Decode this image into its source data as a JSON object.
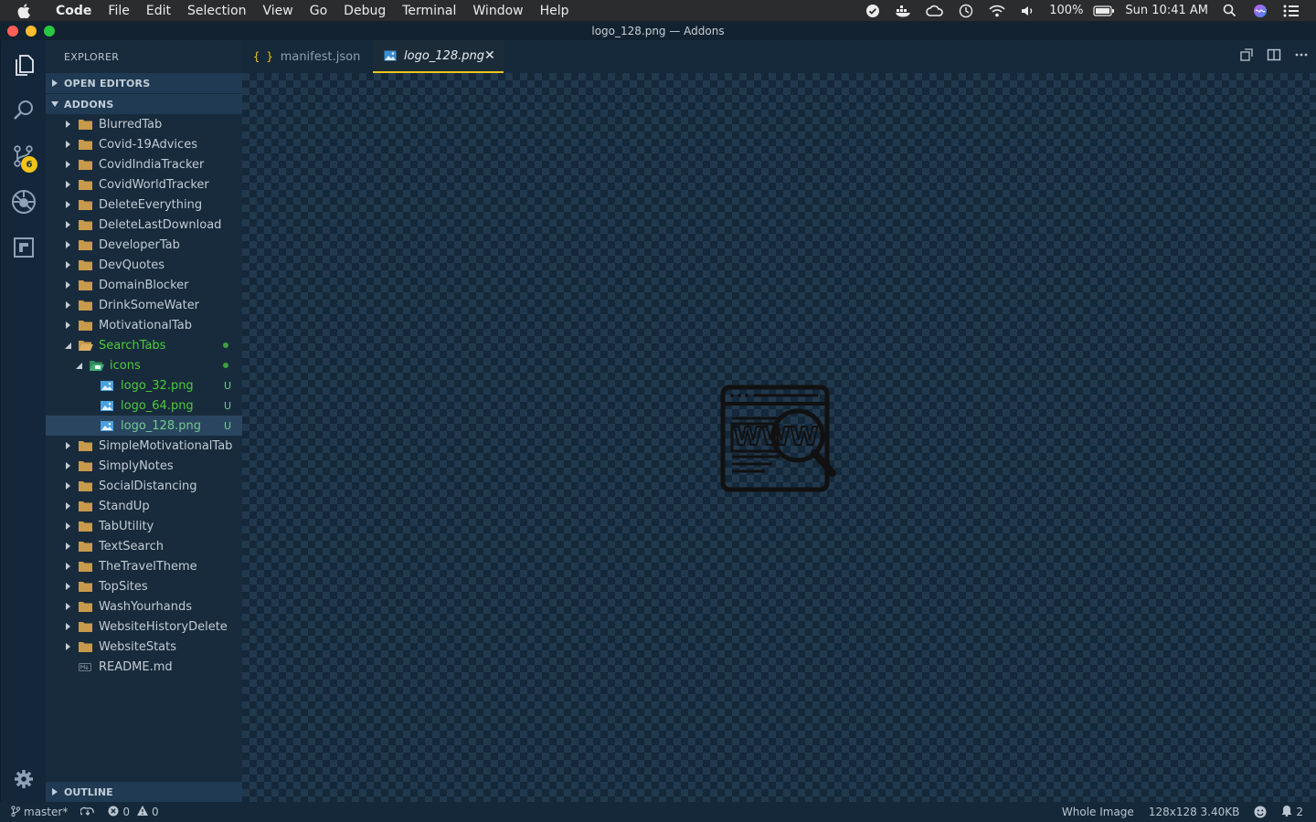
{
  "menubar": {
    "app_name": "Code",
    "items": [
      "File",
      "Edit",
      "Selection",
      "View",
      "Go",
      "Debug",
      "Terminal",
      "Window",
      "Help"
    ],
    "battery": "100%",
    "clock": "Sun 10:41 AM"
  },
  "window": {
    "title": "logo_128.png — Addons"
  },
  "activity": {
    "scm_badge": "6"
  },
  "sidebar": {
    "title": "EXPLORER",
    "open_editors": "OPEN EDITORS",
    "folder": "ADDONS",
    "outline": "OUTLINE",
    "tree": [
      {
        "label": "BlurredTab",
        "kind": "folder",
        "depth": 0
      },
      {
        "label": "Covid-19Advices",
        "kind": "folder",
        "depth": 0
      },
      {
        "label": "CovidIndiaTracker",
        "kind": "folder",
        "depth": 0
      },
      {
        "label": "CovidWorldTracker",
        "kind": "folder",
        "depth": 0
      },
      {
        "label": "DeleteEverything",
        "kind": "folder",
        "depth": 0
      },
      {
        "label": "DeleteLastDownload",
        "kind": "folder",
        "depth": 0
      },
      {
        "label": "DeveloperTab",
        "kind": "folder",
        "depth": 0
      },
      {
        "label": "DevQuotes",
        "kind": "folder",
        "depth": 0
      },
      {
        "label": "DomainBlocker",
        "kind": "folder",
        "depth": 0
      },
      {
        "label": "DrinkSomeWater",
        "kind": "folder",
        "depth": 0
      },
      {
        "label": "MotivationalTab",
        "kind": "folder",
        "depth": 0
      },
      {
        "label": "SearchTabs",
        "kind": "folder-open",
        "depth": 0,
        "dot": true
      },
      {
        "label": "icons",
        "kind": "folder-open-images",
        "depth": 1,
        "dot": true
      },
      {
        "label": "logo_32.png",
        "kind": "image",
        "depth": 2,
        "decor": "U"
      },
      {
        "label": "logo_64.png",
        "kind": "image",
        "depth": 2,
        "decor": "U"
      },
      {
        "label": "logo_128.png",
        "kind": "image",
        "depth": 2,
        "decor": "U",
        "selected": true
      },
      {
        "label": "SimpleMotivationalTab",
        "kind": "folder",
        "depth": 0
      },
      {
        "label": "SimplyNotes",
        "kind": "folder",
        "depth": 0
      },
      {
        "label": "SocialDistancing",
        "kind": "folder",
        "depth": 0
      },
      {
        "label": "StandUp",
        "kind": "folder",
        "depth": 0
      },
      {
        "label": "TabUtility",
        "kind": "folder",
        "depth": 0
      },
      {
        "label": "TextSearch",
        "kind": "folder",
        "depth": 0
      },
      {
        "label": "TheTravelTheme",
        "kind": "folder",
        "depth": 0
      },
      {
        "label": "TopSites",
        "kind": "folder",
        "depth": 0
      },
      {
        "label": "WashYourhands",
        "kind": "folder",
        "depth": 0
      },
      {
        "label": "WebsiteHistoryDelete",
        "kind": "folder",
        "depth": 0
      },
      {
        "label": "WebsiteStats",
        "kind": "folder",
        "depth": 0
      },
      {
        "label": "README.md",
        "kind": "markdown",
        "depth": 0
      }
    ]
  },
  "tabs": [
    {
      "label": "manifest.json",
      "icon": "json-icon",
      "active": false
    },
    {
      "label": "logo_128.png",
      "icon": "image-icon",
      "active": true
    }
  ],
  "image_preview": {
    "logo_text": "WWW"
  },
  "statusbar": {
    "branch": "master*",
    "errors": "0",
    "warnings": "0",
    "zoom": "Whole Image",
    "image_info": "128x128 3.40KB",
    "notifications": "2"
  },
  "colors": {
    "accent": "#f0c419",
    "untracked": "#73c991",
    "folder": "#c89a4b"
  }
}
